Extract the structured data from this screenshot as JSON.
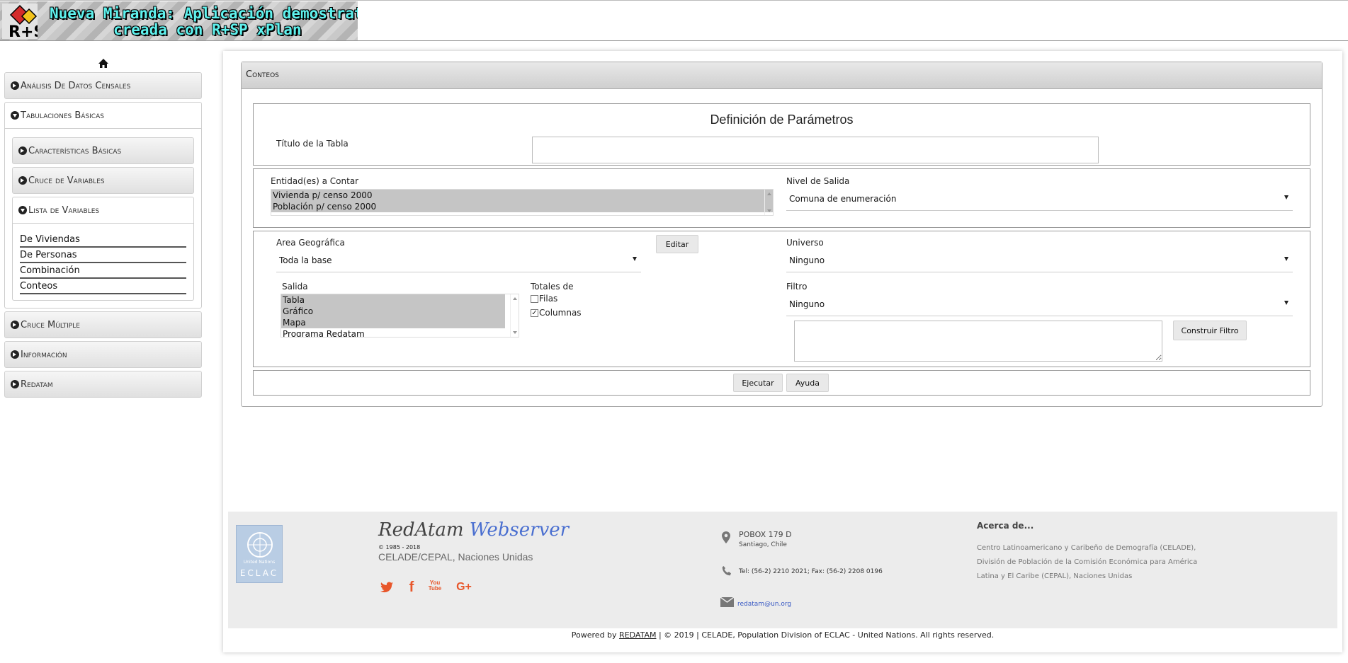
{
  "header": {
    "logo_alt": "R+SP",
    "title_line1": "Nueva Miranda: Aplicación demostrativa",
    "title_line2": "creada con R+SP xPlan"
  },
  "sidebar": {
    "home_icon": "home-icon",
    "sections": [
      {
        "label": "Análisis De Datos Censales",
        "icon": "circle-arrow-right-icon"
      },
      {
        "label": "Tabulaciones Básicas",
        "icon": "circle-arrow-down-icon"
      },
      {
        "label": "Cruce Múltiple",
        "icon": "circle-arrow-right-icon"
      },
      {
        "label": "Información",
        "icon": "circle-arrow-right-icon"
      },
      {
        "label": "Redatam",
        "icon": "circle-arrow-right-icon"
      }
    ],
    "sub_sections": [
      {
        "label": "Características Básicas"
      },
      {
        "label": "Cruce de Variables"
      },
      {
        "label": "Lista de Variables"
      }
    ],
    "links": [
      "De Viviendas",
      "De Personas",
      "Combinación",
      "Conteos"
    ]
  },
  "main": {
    "card_title": "Conteos",
    "params_heading": "Definición de Parámetros",
    "table_title_label": "Título de la Tabla",
    "table_title_value": "",
    "entities_label": "Entidad(es) a Contar",
    "entities": [
      "Vivienda p/ censo 2000",
      "Población p/ censo 2000"
    ],
    "output_level_label": "Nivel de Salida",
    "output_level_value": "Comuna de enumeración",
    "geo_area_label": "Area Geográfica",
    "geo_area_value": "Toda la base",
    "edit_button": "Editar",
    "universe_label": "Universo",
    "universe_value": "Ninguno",
    "output_label": "Salida",
    "output_options": [
      "Tabla",
      "Gráfico",
      "Mapa",
      "Programa Redatam"
    ],
    "totals_label": "Totales de",
    "totals_rows": "Filas",
    "totals_columns": "Columnas",
    "totals_rows_checked": false,
    "totals_columns_checked": true,
    "filter_label": "Filtro",
    "filter_value": "Ninguno",
    "build_filter_button": "Construir Filtro",
    "execute_button": "Ejecutar",
    "help_button": "Ayuda"
  },
  "footer": {
    "brand_part1": "RedAtam",
    "brand_part2": "Webserver",
    "copyright_years": "© 1985 - 2018",
    "org": "CELADE/CEPAL, Naciones Unidas",
    "un_logo_text_1": "United Nations",
    "un_logo_text_2": "ECLAC",
    "social": [
      "twitter-icon",
      "facebook-icon",
      "youtube-icon",
      "google-plus-icon"
    ],
    "social_youtube_text": "You Tube",
    "social_google_text": "G+",
    "address_line1": "POBOX 179 D",
    "address_line2": "Santiago, Chile",
    "phone": "Tel: (56-2) 2210 2021; Fax: (56-2) 2208 0196",
    "email": "redatam@un.org",
    "about_title": "Acerca de...",
    "about_line1": "Centro Latinoamericano y Caribeño de Demografía (CELADE),",
    "about_line2": "División de Población de la Comisión Económica para América",
    "about_line3": "Latina y El Caribe (CEPAL), Naciones Unidas",
    "powered_prefix": "Powered by",
    "powered_link": "REDATAM",
    "powered_suffix": "| © 2019 | CELADE, Population Division of ECLAC - United Nations. All rights reserved.",
    "accent_color": "#e8562a",
    "brand_blue": "#4a6fd0"
  }
}
